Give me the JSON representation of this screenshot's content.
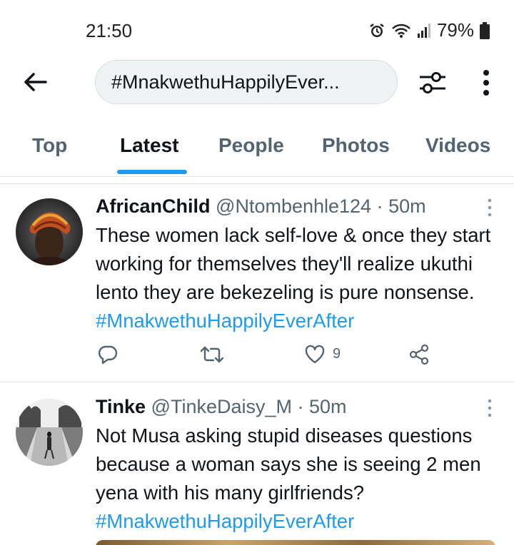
{
  "status_bar": {
    "time": "21:50",
    "battery": "79%",
    "icons": [
      "alarm-icon",
      "wifi-icon",
      "signal-icon",
      "battery-icon"
    ]
  },
  "header": {
    "search_query": "#MnakwethuHappilyEver...",
    "icons": [
      "back-arrow-icon",
      "filter-icon",
      "more-vertical-icon"
    ]
  },
  "tabs": [
    {
      "label": "Top",
      "active": false
    },
    {
      "label": "Latest",
      "active": true
    },
    {
      "label": "People",
      "active": false
    },
    {
      "label": "Photos",
      "active": false
    },
    {
      "label": "Videos",
      "active": false
    }
  ],
  "tweets": [
    {
      "display_name": "AfricanChild",
      "meta": "@Ntombenhle124 · 50m",
      "text": "These women lack self-love & once they start working for themselves they'll realize ukuthi lento they are bekezeling is pure nonsense.",
      "hashtag": "#MnakwethuHappilyEverAfter",
      "likes": "9"
    },
    {
      "display_name": "Tinke",
      "meta": "@TinkeDaisy_M · 50m",
      "text": "Not Musa asking stupid diseases questions because a woman says she is seeing 2 men yena with his many girlfriends?",
      "hashtag": "#MnakwethuHappilyEverAfter"
    }
  ],
  "colors": {
    "accent": "#1d9bf0",
    "text_primary": "#0f1419",
    "text_secondary": "#536471",
    "divider": "#e1e6e9",
    "search_bg": "#eff3f4"
  }
}
